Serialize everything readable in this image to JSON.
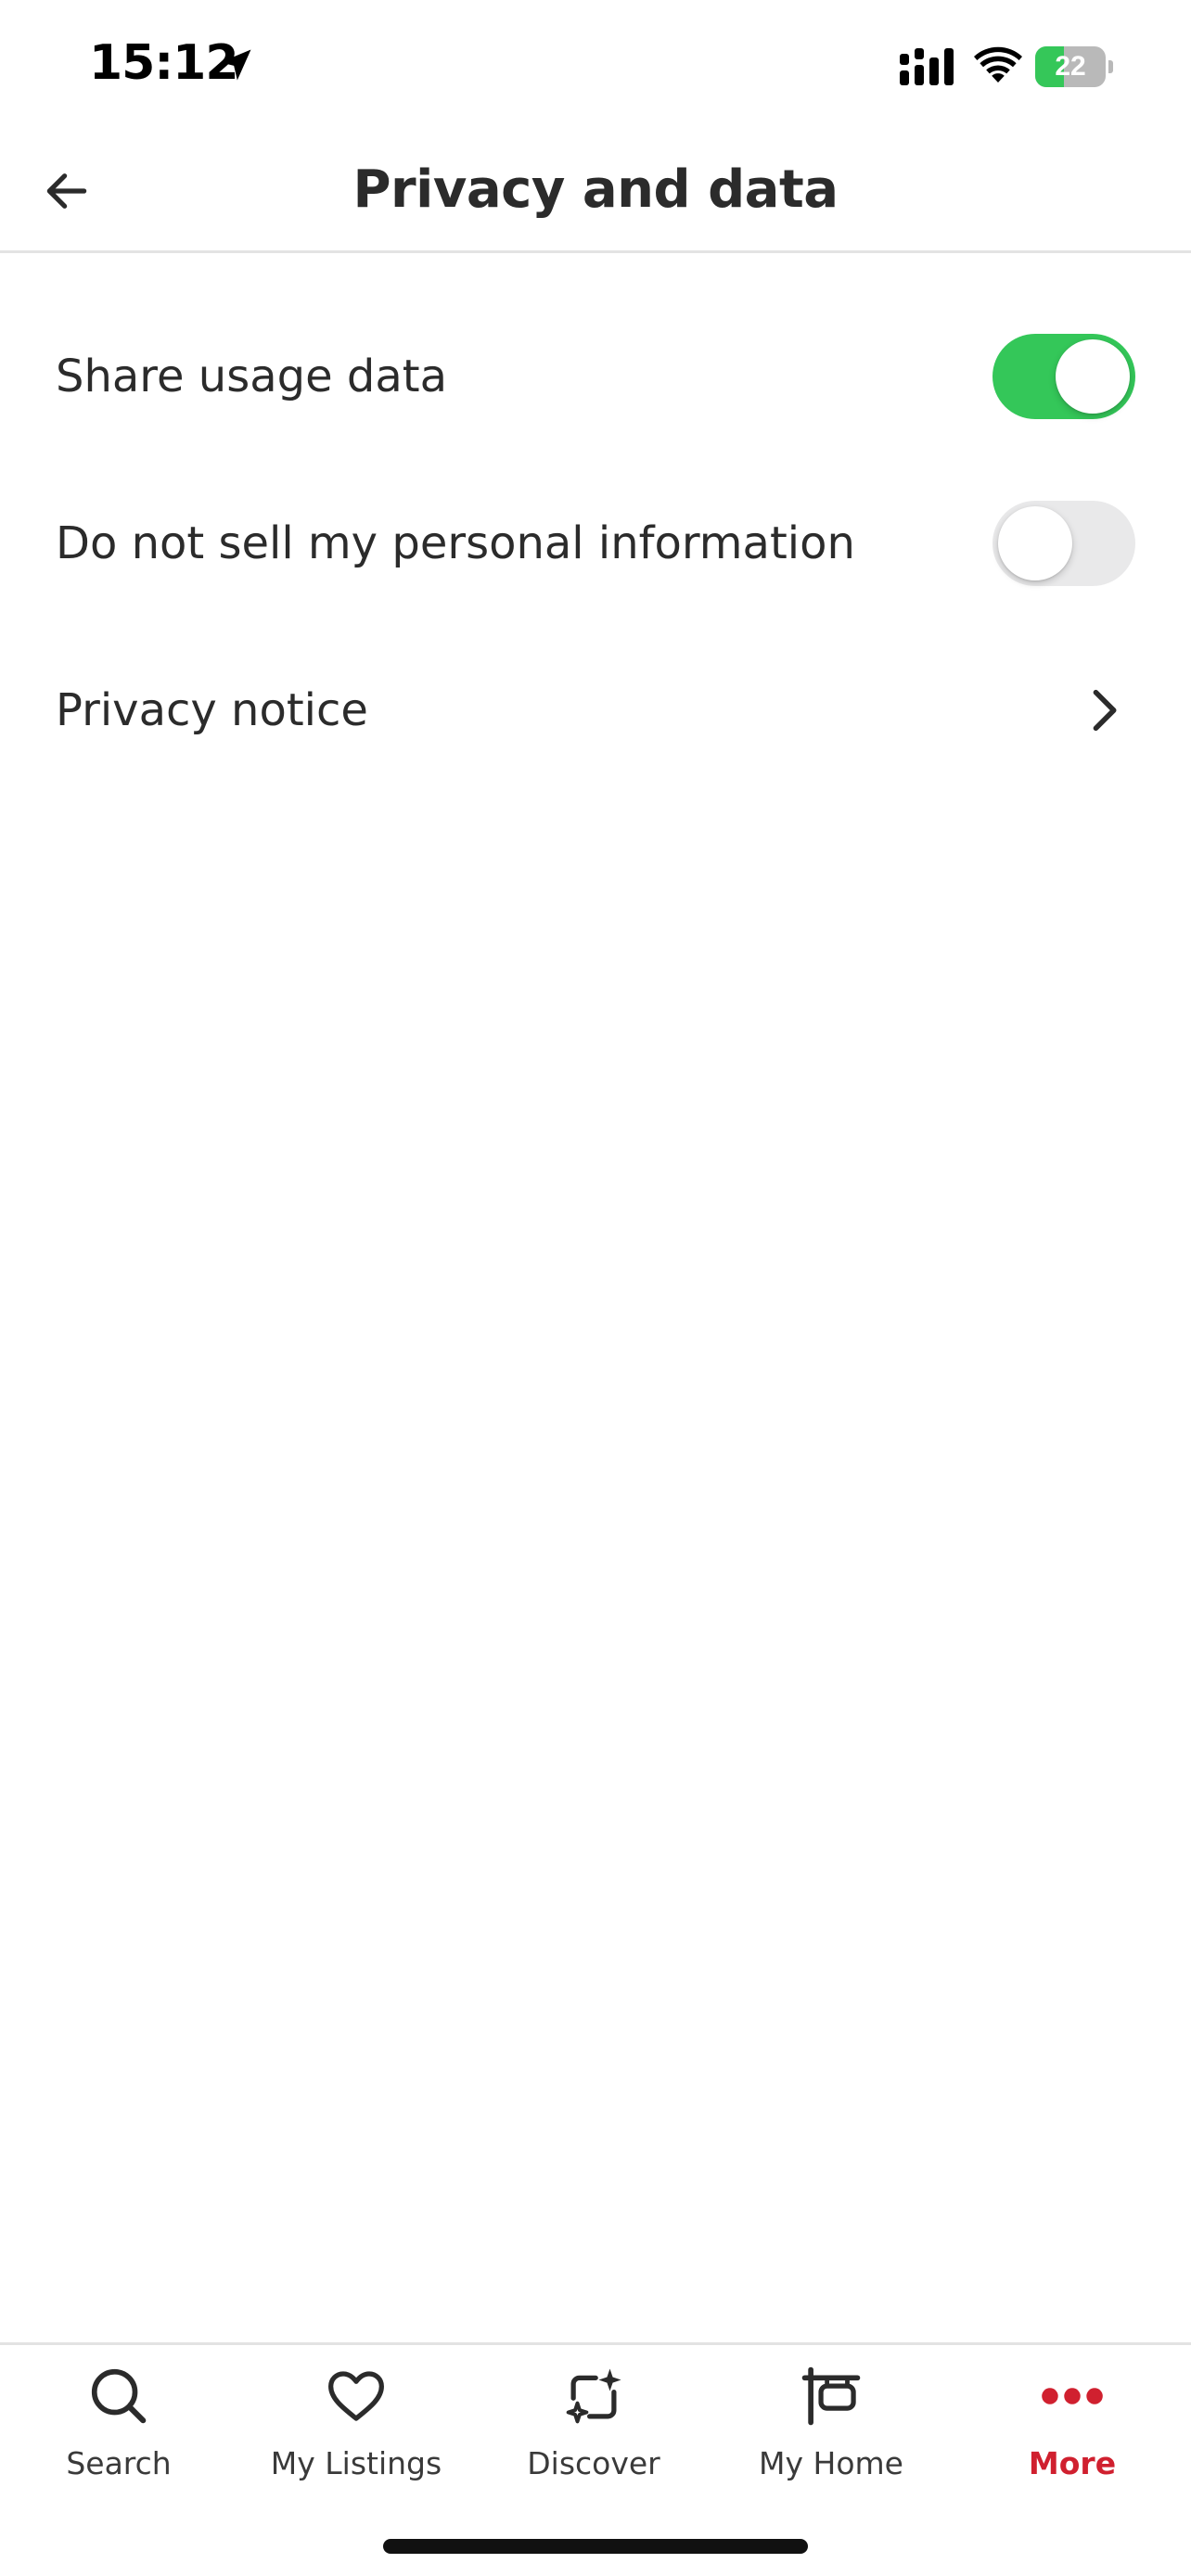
{
  "status_bar": {
    "time": "15:12",
    "battery_level": "22",
    "battery_fraction": 0.22,
    "location_icon": "location-arrow-icon",
    "signal_icon": "cell-signal-icon",
    "wifi_icon": "wifi-icon",
    "charging": true
  },
  "header": {
    "title": "Privacy and data",
    "back_icon": "arrow-left-icon"
  },
  "settings": {
    "share_usage": {
      "label": "Share usage data",
      "enabled": true
    },
    "do_not_sell": {
      "label": "Do not sell my personal information",
      "enabled": false
    },
    "privacy_notice": {
      "label": "Privacy notice",
      "icon": "chevron-right-icon"
    }
  },
  "tabs": [
    {
      "label": "Search",
      "icon": "search-icon",
      "active": false
    },
    {
      "label": "My Listings",
      "icon": "heart-icon",
      "active": false
    },
    {
      "label": "Discover",
      "icon": "discover-sparkle-icon",
      "active": false
    },
    {
      "label": "My Home",
      "icon": "home-sign-icon",
      "active": false
    },
    {
      "label": "More",
      "icon": "more-dots-icon",
      "active": true
    }
  ],
  "colors": {
    "toggle_on": "#34c759",
    "toggle_off": "#e9e9ea",
    "accent": "#d0202f",
    "text": "#2b2b2b",
    "battery_fill": "#35c759"
  }
}
